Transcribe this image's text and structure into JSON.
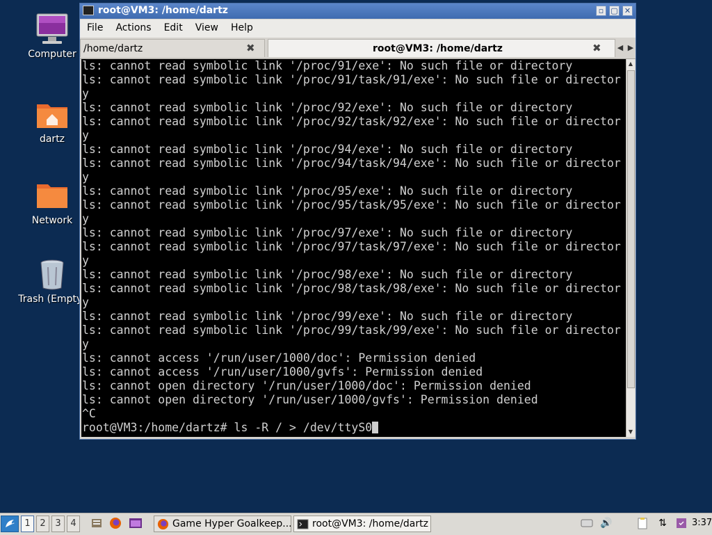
{
  "desktop": {
    "icons": [
      {
        "label": "Computer",
        "icon": "computer-icon"
      },
      {
        "label": "dartz",
        "icon": "home-folder-icon"
      },
      {
        "label": "Network",
        "icon": "network-folder-icon"
      },
      {
        "label": "Trash (Empty)",
        "icon": "trash-icon"
      }
    ]
  },
  "window": {
    "title": "root@VM3: /home/dartz",
    "buttons": {
      "minimize": "▫",
      "maximize": "▢",
      "close": "✕"
    },
    "menu": [
      "File",
      "Actions",
      "Edit",
      "View",
      "Help"
    ],
    "tabs": [
      {
        "label": "/home/dartz",
        "active": false,
        "close": "✖"
      },
      {
        "label": "root@VM3: /home/dartz",
        "active": true,
        "close": "✖"
      }
    ],
    "tab_arrows": {
      "left": "◀",
      "right": "▶"
    }
  },
  "terminal": {
    "lines": [
      "ls: cannot read symbolic link '/proc/91/exe': No such file or directory",
      "ls: cannot read symbolic link '/proc/91/task/91/exe': No such file or director",
      "y",
      "ls: cannot read symbolic link '/proc/92/exe': No such file or directory",
      "ls: cannot read symbolic link '/proc/92/task/92/exe': No such file or director",
      "y",
      "ls: cannot read symbolic link '/proc/94/exe': No such file or directory",
      "ls: cannot read symbolic link '/proc/94/task/94/exe': No such file or director",
      "y",
      "ls: cannot read symbolic link '/proc/95/exe': No such file or directory",
      "ls: cannot read symbolic link '/proc/95/task/95/exe': No such file or director",
      "y",
      "ls: cannot read symbolic link '/proc/97/exe': No such file or directory",
      "ls: cannot read symbolic link '/proc/97/task/97/exe': No such file or director",
      "y",
      "ls: cannot read symbolic link '/proc/98/exe': No such file or directory",
      "ls: cannot read symbolic link '/proc/98/task/98/exe': No such file or director",
      "y",
      "ls: cannot read symbolic link '/proc/99/exe': No such file or directory",
      "ls: cannot read symbolic link '/proc/99/task/99/exe': No such file or director",
      "y",
      "ls: cannot access '/run/user/1000/doc': Permission denied",
      "ls: cannot access '/run/user/1000/gvfs': Permission denied",
      "ls: cannot open directory '/run/user/1000/doc': Permission denied",
      "ls: cannot open directory '/run/user/1000/gvfs': Permission denied",
      "^C"
    ],
    "prompt": "root@VM3:/home/dartz# ",
    "command": "ls -R / > /dev/ttyS0"
  },
  "taskbar": {
    "workspaces": [
      "1",
      "2",
      "3",
      "4"
    ],
    "active_workspace": "1",
    "tasks": [
      {
        "label": "Game Hyper Goalkeep...",
        "icon": "firefox-icon"
      },
      {
        "label": "root@VM3: /home/dartz",
        "icon": "terminal-icon"
      }
    ],
    "clock": "3:37"
  },
  "colors": {
    "desktop_bg": "#0c2b52",
    "titlebar": "#4a78bd",
    "terminal_bg": "#000000",
    "terminal_fg": "#d0d0d0"
  }
}
